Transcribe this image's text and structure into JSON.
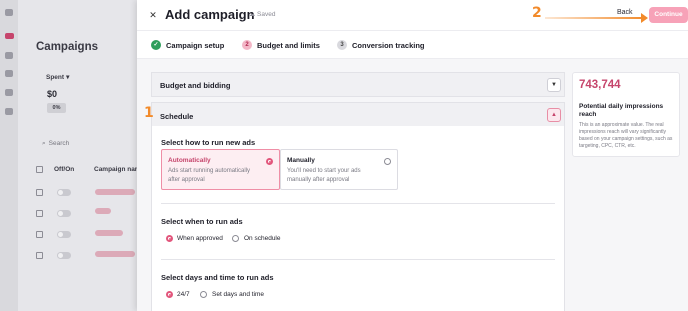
{
  "background_app": {
    "page_title": "Campaigns",
    "spent_label": "Spent",
    "spent_value": "$0",
    "spent_percent": "0%",
    "search_placeholder": "Search",
    "columns": [
      "Off/On",
      "Campaign name"
    ]
  },
  "modal": {
    "title": "Add campaign",
    "saved_status": "Saved",
    "back_label": "Back",
    "continue_label": "Continue",
    "annotation_step_1": "1",
    "annotation_step_2": "2"
  },
  "steps": [
    {
      "label": "Campaign setup",
      "state": "done",
      "number": "✓"
    },
    {
      "label": "Budget and limits",
      "state": "active",
      "number": "2"
    },
    {
      "label": "Conversion tracking",
      "state": "upcoming",
      "number": "3"
    }
  ],
  "sections": {
    "budget": {
      "title": "Budget and bidding",
      "expanded": false
    },
    "schedule": {
      "title": "Schedule",
      "expanded": true
    }
  },
  "schedule": {
    "how_label": "Select how to run new ads",
    "options": [
      {
        "title": "Automatically",
        "description": "Ads start running automatically after approval",
        "selected": true
      },
      {
        "title": "Manually",
        "description": "You'll need to start your ads manually after approval",
        "selected": false
      }
    ],
    "when_label": "Select when to run ads",
    "when_options": [
      {
        "label": "When approved",
        "selected": true
      },
      {
        "label": "On schedule",
        "selected": false
      }
    ],
    "days_label": "Select days and time to run ads",
    "days_options": [
      {
        "label": "24/7",
        "selected": true
      },
      {
        "label": "Set days and time",
        "selected": false
      }
    ]
  },
  "reach": {
    "value": "743,744",
    "title": "Potential daily impressions reach",
    "description": "This is an approximate value. The real impressions reach will vary significantly based on your campaign settings, such as targeting, CPC, CTR, etc."
  },
  "colors": {
    "accent": "#c6456c",
    "annotation": "#f28a2a",
    "success": "#2e9e5b"
  }
}
